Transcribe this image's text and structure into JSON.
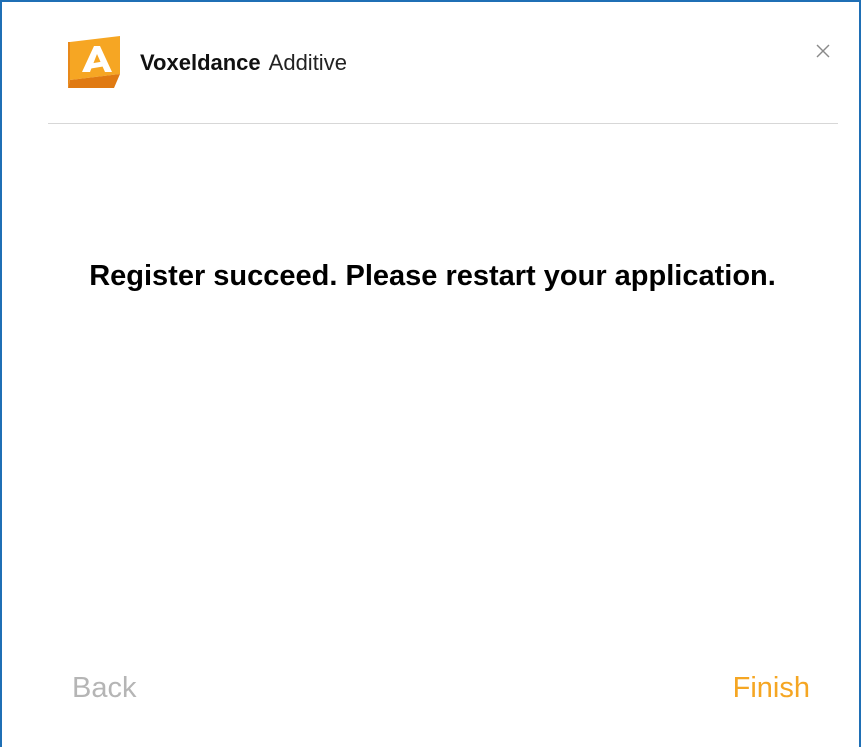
{
  "header": {
    "brand_name": "Voxeldance",
    "product_name": "Additive",
    "logo_icon": "voxeldance-logo-icon",
    "close_icon": "close-icon"
  },
  "main": {
    "message": "Register succeed. Please restart your application."
  },
  "footer": {
    "back_label": "Back",
    "finish_label": "Finish"
  },
  "colors": {
    "accent": "#f5a623",
    "disabled_text": "#b5b5b5",
    "window_border": "#1f6fb5",
    "divider": "#d7d7d7"
  }
}
